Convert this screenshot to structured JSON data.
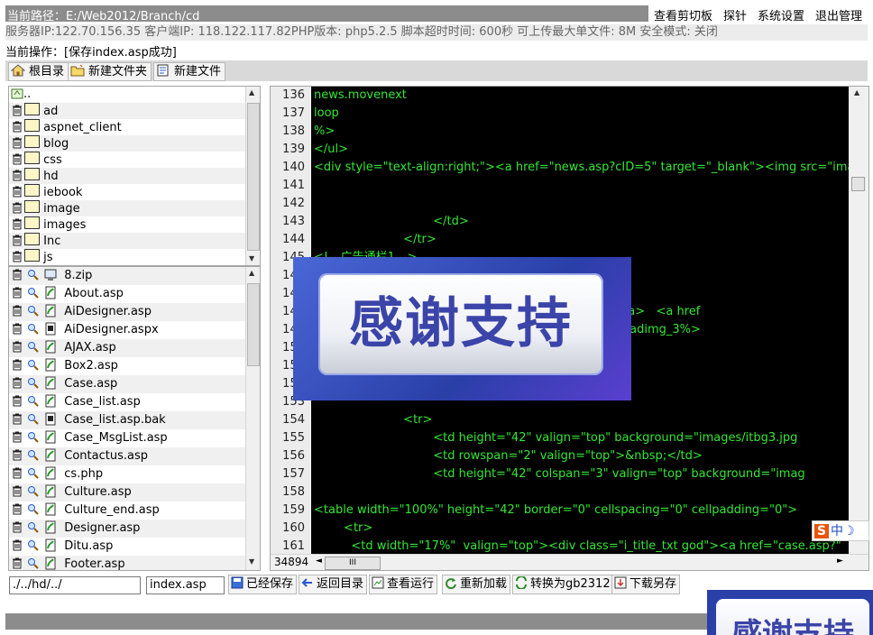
{
  "header": {
    "current_path": "当前路径：E:/Web2012/Branch/cd",
    "links": [
      "查看剪切板",
      "探针",
      "系统设置",
      "退出管理"
    ]
  },
  "server_info": "服务器IP:122.70.156.35 客户端IP:  118.122.117.82PHP版本: php5.2.5 脚本超时时间: 600秒 可上传最大单文件: 8M 安全模式: 关闭",
  "current_operation": "当前操作：[保存index.asp成功]",
  "toolbar": {
    "root_dir": "根目录",
    "new_folder": "新建文件夹",
    "new_file": "新建文件"
  },
  "folders": {
    "parent": "..",
    "items": [
      "ad",
      "aspnet_client",
      "blog",
      "css",
      "hd",
      "iebook",
      "image",
      "images",
      "Inc",
      "js"
    ]
  },
  "files": {
    "items": [
      "8.zip",
      "About.asp",
      "AiDesigner.asp",
      "AiDesigner.aspx",
      "AJAX.asp",
      "Box2.asp",
      "Case.asp",
      "Case_list.asp",
      "Case_list.asp.bak",
      "Case_MsgList.asp",
      "Contactus.asp",
      "cs.php",
      "Culture.asp",
      "Culture_end.asp",
      "Designer.asp",
      "Ditu.asp",
      "Footer.asp"
    ]
  },
  "editor": {
    "line_numbers": [
      "136",
      "137",
      "138",
      "139",
      "140",
      "141",
      "142",
      "143",
      "144",
      "145",
      "146",
      "147",
      "148",
      "149",
      "150",
      "151",
      "152",
      "153",
      "154",
      "155",
      "156",
      "157",
      "158",
      "159",
      "160",
      "161"
    ],
    "lines": [
      "news.movenext",
      "loop",
      "%>",
      "</ul>",
      "<div style=\"text-align:right;\"><a href=\"news.asp?cID=5\" target=\"_blank\"><img src=\"images",
      "",
      "",
      "                                </td>",
      "                        </tr>",
      "<!-- 广告通栏1 -->",
      "",
      "",
      "                                            \"hd/A.gif\" border=\"0\"></a>   <a href",
      "                                            ranch.dyrs.com.cn<%=c_adimg_3%>",
      "",
      "",
      "",
      "",
      "                        <tr>",
      "                                <td height=\"42\" valign=\"top\" background=\"images/itbg3.jpg",
      "                                <td rowspan=\"2\" valign=\"top\">&nbsp;</td>",
      "                                <td height=\"42\" colspan=\"3\" valign=\"top\" background=\"imag",
      "",
      "<table width=\"100%\" height=\"42\" border=\"0\" cellspacing=\"0\" cellpadding=\"0\">",
      "        <tr>",
      "          <td width=\"17%\"  valign=\"top\"><div class=\"i_title_txt god\"><a href=\"case.asp?\""
    ],
    "char_count": "34894",
    "hscroll_glyph": "III"
  },
  "banner_text": "感谢支持",
  "ime_text": "中",
  "bottom": {
    "path_value": "./../hd/../",
    "filename_value": "index.asp",
    "buttons": [
      "已经保存",
      "返回目录",
      "查看运行",
      "重新加载",
      "转换为gb2312",
      "下载另存"
    ]
  }
}
